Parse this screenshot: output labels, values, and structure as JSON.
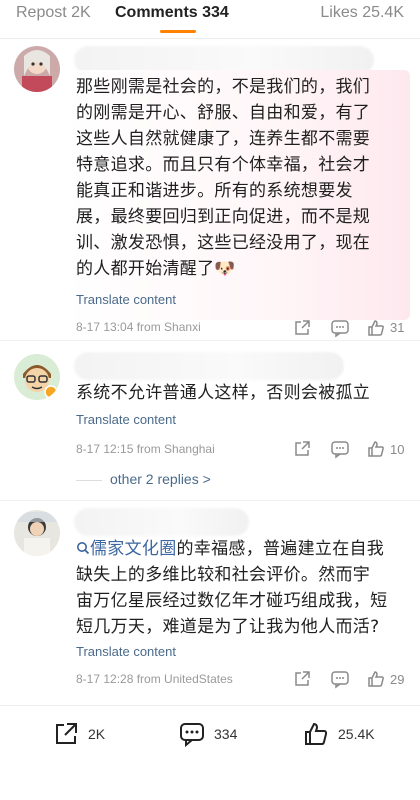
{
  "tabs": {
    "repost": "Repost 2K",
    "comments": "Comments 334",
    "likes": "Likes 25.4K"
  },
  "comments": [
    {
      "text_lines": [
        "那些刚需是社会的，不是我们的，我们",
        "的刚需是开心、舒服、自由和爱，有了",
        "这些人自然就健康了，连养生都不需要",
        "特意追求。而且只有个体幸福，社会才",
        "能真正和谐进步。所有的系统想要发",
        "展，最终要回归到正向促进，而不是规",
        "训、激发恐惧，这些已经没用了，现在",
        "的人都开始清醒了🐶"
      ],
      "translate": "Translate content",
      "meta": "8-17 13:04 from Shanxi",
      "likes": "31"
    },
    {
      "text_lines": [
        "系统不允许普通人这样，否则会被孤立"
      ],
      "translate": "Translate content",
      "meta": "8-17 12:15 from Shanghai",
      "likes": "10",
      "replies": "other 2 replies >"
    },
    {
      "tag": "儒家文化圈",
      "text_line1_rest": "的幸福感，普遍建立在自我",
      "text_lines": [
        "缺失上的多维比较和社会评价。然而宇",
        "宙万亿星辰经过数亿年才碰巧组成我，短",
        "短几万天，难道是为了让我为他人而活?"
      ],
      "translate": "Translate content",
      "meta": "8-17 12:28 from UnitedStates",
      "likes": "29"
    }
  ],
  "bottombar": {
    "share": "2K",
    "comment": "334",
    "like": "25.4K"
  },
  "colors": {
    "accent": "#ff8200",
    "link": "#4a6a8a",
    "muted": "#9a9a9a"
  },
  "icons": [
    "share-icon",
    "comment-icon",
    "like-icon",
    "search-icon",
    "emoji-dog-icon"
  ]
}
